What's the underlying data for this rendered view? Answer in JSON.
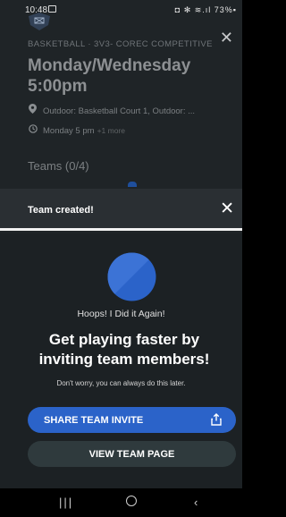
{
  "status_bar": {
    "time": "10:48",
    "system_icons": "◘ ✻ ≋.ıl 73%▪"
  },
  "header": {
    "sport": "BASKETBALL",
    "separator": "·",
    "league": "3V3- COREC COMPETITIVE",
    "title": "Monday/Wednesday 5:00pm",
    "location": "Outdoor: Basketball Court 1, Outdoor: ...",
    "time": "Monday 5 pm",
    "time_more": "+1 more",
    "teams_heading": "Teams (0/4)"
  },
  "banner": {
    "text": "Team created!"
  },
  "sheet": {
    "team_name": "Hoops! I Did it Again!",
    "headline": "Get playing faster by inviting team members!",
    "subtext": "Don't worry, you can always do this later.",
    "share_button": "SHARE TEAM INVITE",
    "view_button": "VIEW TEAM PAGE"
  },
  "nav": {
    "recent": "|||",
    "back": "‹"
  },
  "colors": {
    "accent": "#2b63c9",
    "sheet_bg": "#1c2124",
    "secondary_button": "#2f3a3d"
  },
  "icons": [
    "logo-icon",
    "close-icon",
    "location-pin-icon",
    "clock-icon",
    "team-ball-icon",
    "share-icon",
    "home-icon"
  ]
}
